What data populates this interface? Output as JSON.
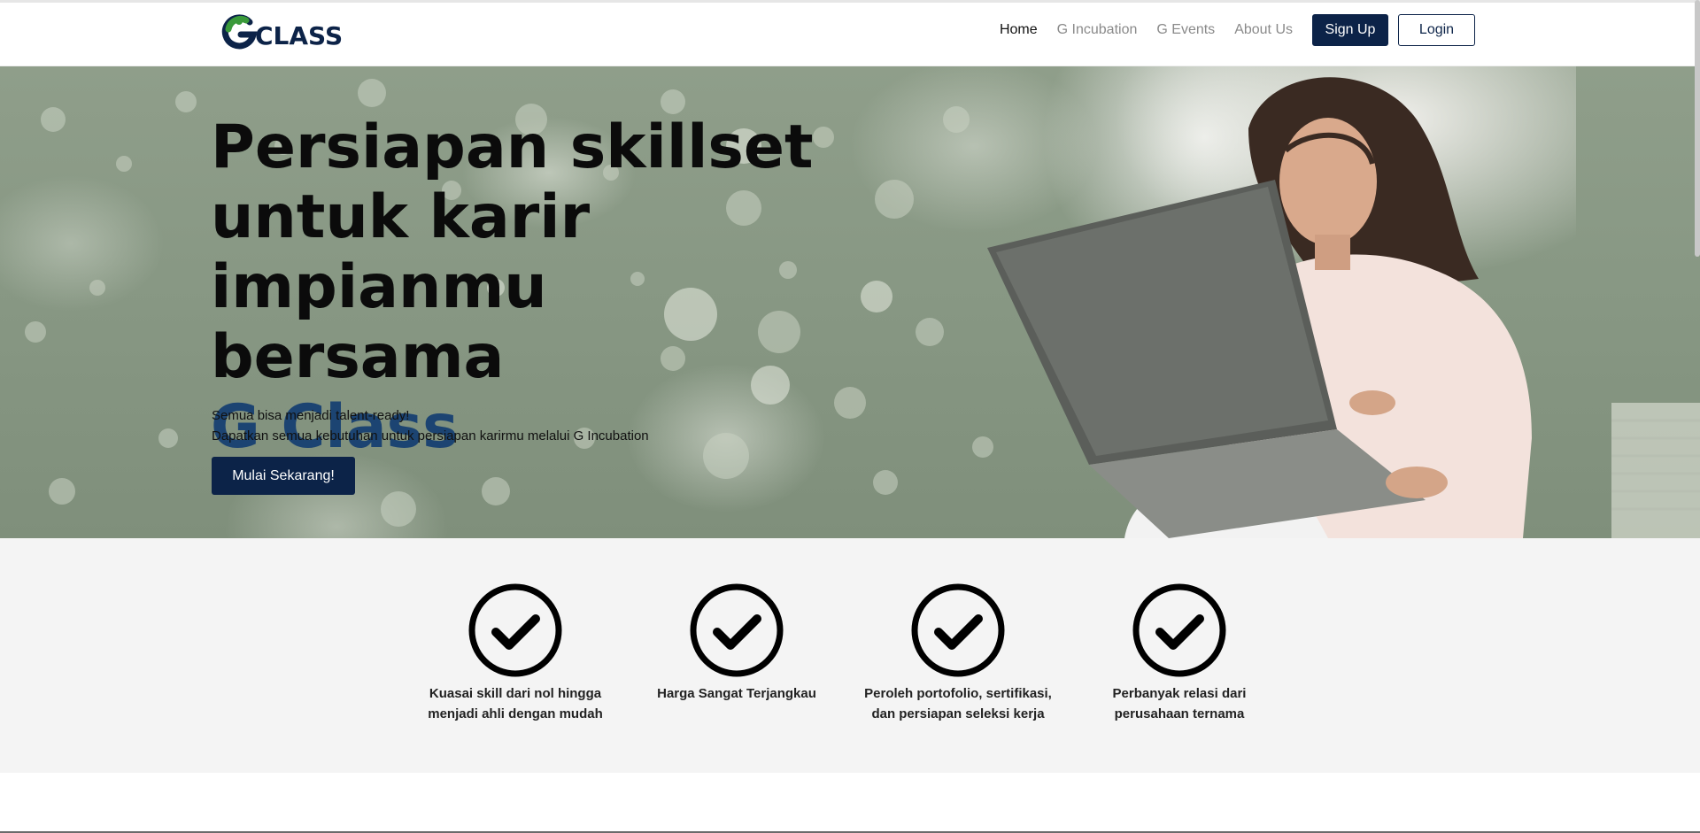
{
  "brand": {
    "logo_text": "CLASS",
    "logo_icon": "g-class-logo-icon",
    "colors": {
      "navy": "#0c2348",
      "brand_blue": "#1c4472",
      "green": "#3a9a3a"
    }
  },
  "nav": {
    "links": [
      {
        "label": "Home",
        "active": true
      },
      {
        "label": "G Incubation",
        "active": false
      },
      {
        "label": "G Events",
        "active": false
      },
      {
        "label": "About Us",
        "active": false
      }
    ],
    "signup_label": "Sign Up",
    "login_label": "Login"
  },
  "hero": {
    "title_line1": "Persiapan skillset",
    "title_line2": "untuk karir",
    "title_line3": "impianmu bersama",
    "title_brand": "G Class",
    "subtitle_line1": "Semua bisa menjadi talent-ready!",
    "subtitle_line2": "Dapatkan semua kebutuhan untuk persiapan karirmu melalui G Incubation",
    "cta_label": "Mulai Sekarang!"
  },
  "features": [
    {
      "icon": "check-circle-icon",
      "line1": "Kuasai skill dari nol hingga",
      "line2": "menjadi ahli dengan mudah"
    },
    {
      "icon": "check-circle-icon",
      "line1": "Harga Sangat Terjangkau",
      "line2": ""
    },
    {
      "icon": "check-circle-icon",
      "line1": "Peroleh portofolio, sertifikasi,",
      "line2": "dan persiapan seleksi kerja"
    },
    {
      "icon": "check-circle-icon",
      "line1": "Perbanyak relasi dari",
      "line2": "perusahaan ternama"
    }
  ]
}
